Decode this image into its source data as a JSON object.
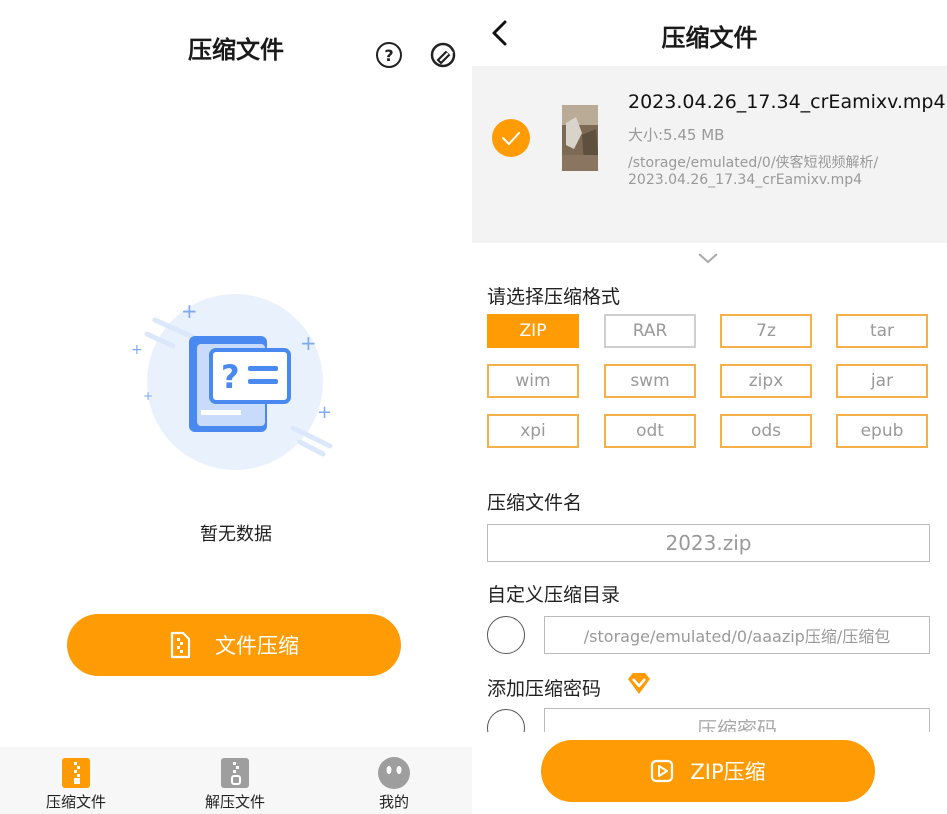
{
  "left": {
    "title": "压缩文件",
    "empty_text": "暂无数据",
    "compress_button_label": "文件压缩",
    "tabs": [
      {
        "label": "压缩文件",
        "icon": "zip-file-icon",
        "active": true
      },
      {
        "label": "解压文件",
        "icon": "unzip-file-icon",
        "active": false
      },
      {
        "label": "我的",
        "icon": "profile-face-icon",
        "active": false
      }
    ]
  },
  "right": {
    "title": "压缩文件",
    "file": {
      "name": "2023.04.26_17.34_crEamixv.mp4",
      "size": "大小:5.45 MB",
      "path_line1": "/storage/emulated/0/侠客短视频解析/",
      "path_line2": "2023.04.26_17.34_crEamixv.mp4",
      "checked": true
    },
    "format_label": "请选择压缩格式",
    "formats": [
      "ZIP",
      "RAR",
      "7z",
      "tar",
      "wim",
      "swm",
      "zipx",
      "jar",
      "xpi",
      "odt",
      "ods",
      "epub"
    ],
    "selected_format": "ZIP",
    "filename_label": "压缩文件名",
    "filename_value": "2023.zip",
    "custom_dir_label": "自定义压缩目录",
    "custom_dir_value": "/storage/emulated/0/aaazip压缩/压缩包",
    "password_label": "添加压缩密码",
    "password_placeholder": "压缩密码",
    "action_button_label": "ZIP压缩"
  },
  "colors": {
    "accent": "#ff9b05",
    "format_border": "#f6b04a",
    "illustration_blue": "#4a8af0"
  }
}
